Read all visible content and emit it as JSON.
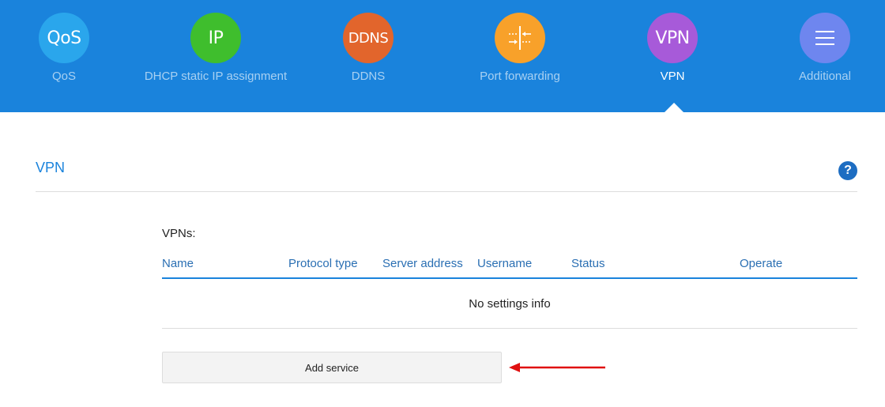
{
  "nav": {
    "items": [
      {
        "icon_text": "QoS",
        "label": "QoS",
        "color": "#2aa6ec"
      },
      {
        "icon_text": "IP",
        "label": "DHCP static IP assignment",
        "color": "#3fbe2d"
      },
      {
        "icon_text": "DDNS",
        "label": "DDNS",
        "color": "#e2652c"
      },
      {
        "icon": "port-forwarding-icon",
        "label": "Port forwarding",
        "color": "#f8a12a"
      },
      {
        "icon_text": "VPN",
        "label": "VPN",
        "color": "#a75ad9",
        "active": true
      },
      {
        "icon": "menu-lines-icon",
        "label": "Additional",
        "color": "#6e86ef"
      }
    ]
  },
  "section": {
    "title": "VPN",
    "help_icon": "question-mark-icon",
    "help_text": "?"
  },
  "vpn_table": {
    "caption": "VPNs:",
    "columns": [
      "Name",
      "Protocol type",
      "Server address",
      "Username",
      "Status",
      "Operate"
    ],
    "empty_text": "No settings info"
  },
  "actions": {
    "add_service_label": "Add service",
    "annotation_arrow_color": "#e01010"
  }
}
